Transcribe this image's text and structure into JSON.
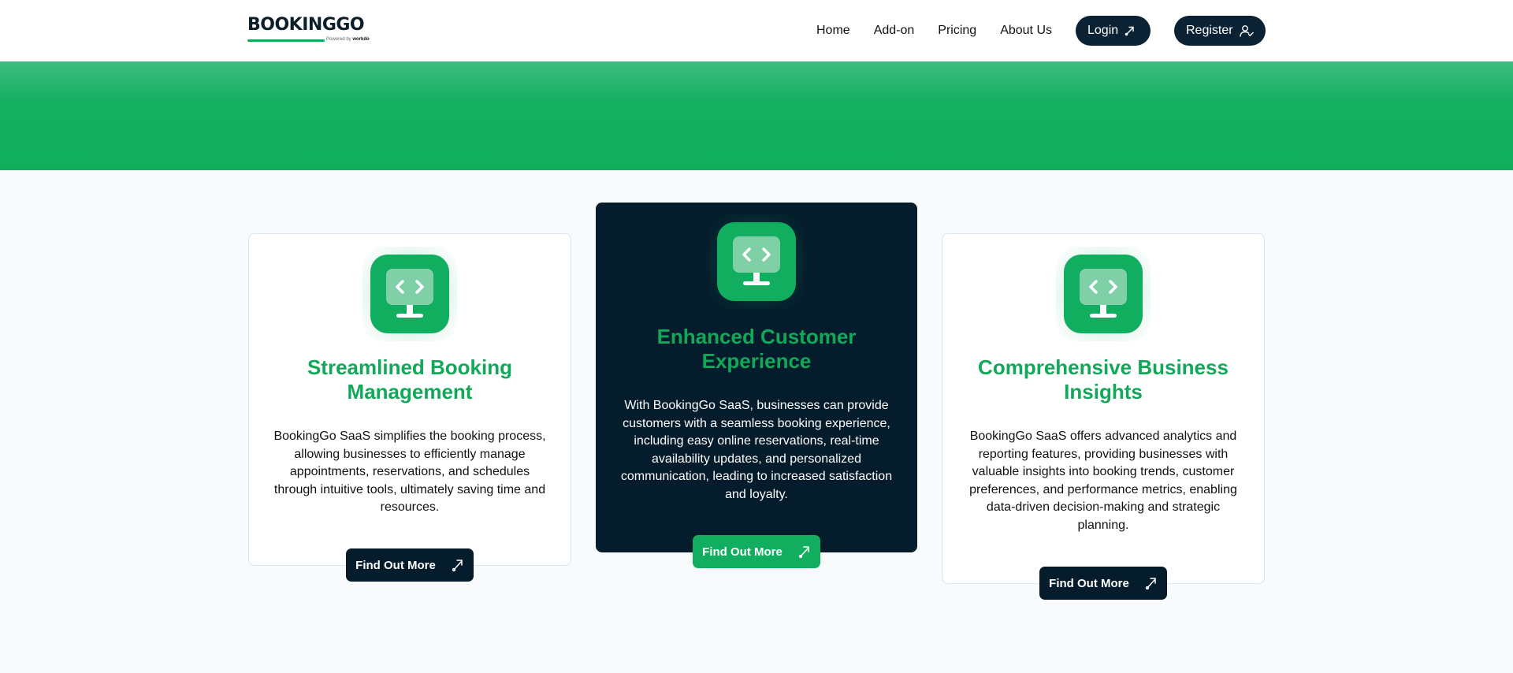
{
  "brand": {
    "logo_text": "BOOKINGGO",
    "logo_sub_prefix": "Powered by",
    "logo_sub_brand": "workdo"
  },
  "nav": {
    "links": [
      "Home",
      "Add-on",
      "Pricing",
      "About Us"
    ],
    "login_label": "Login",
    "register_label": "Register"
  },
  "colors": {
    "accent_green": "#12ae5f",
    "dark_navy": "#041c2b"
  },
  "features": [
    {
      "title": "Streamlined Booking Management",
      "description": "BookingGo SaaS simplifies the booking process, allowing businesses to efficiently manage appointments, reservations, and schedules through intuitive tools, ultimately saving time and resources.",
      "cta": "Find Out More",
      "icon": "monitor-code-icon"
    },
    {
      "title": "Enhanced Customer Experience",
      "description": "With BookingGo SaaS, businesses can provide customers with a seamless booking experience, including easy online reservations, real-time availability updates, and personalized communication, leading to increased satisfaction and loyalty.",
      "cta": "Find Out More",
      "icon": "monitor-code-icon"
    },
    {
      "title": "Comprehensive Business Insights",
      "description": "BookingGo SaaS offers advanced analytics and reporting features, providing businesses with valuable insights into booking trends, customer preferences, and performance metrics, enabling data-driven decision-making and strategic planning.",
      "cta": "Find Out More",
      "icon": "monitor-code-icon"
    }
  ]
}
